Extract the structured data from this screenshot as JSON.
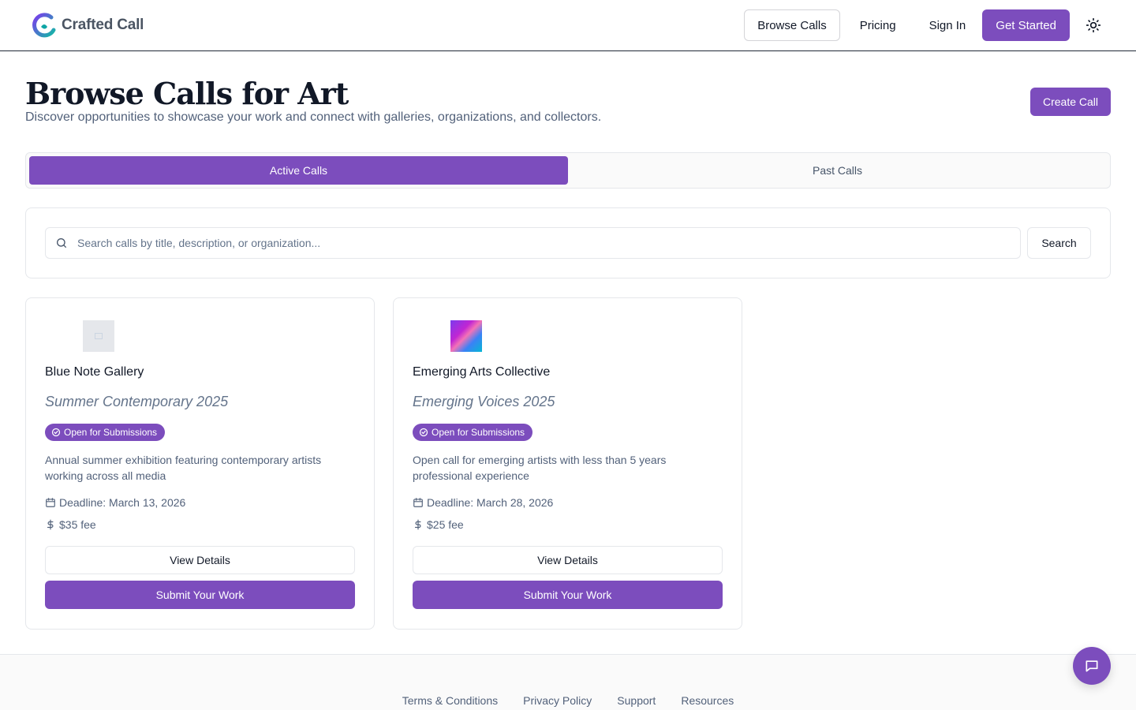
{
  "brand": {
    "name": "Crafted Call"
  },
  "nav": {
    "browse_calls": "Browse Calls",
    "pricing": "Pricing",
    "sign_in": "Sign In",
    "get_started": "Get Started",
    "theme_icon": "sun-icon"
  },
  "page": {
    "title": "Browse Calls for Art",
    "subtitle": "Discover opportunities to showcase your work and connect with galleries, organizations, and collectors.",
    "create_call": "Create Call"
  },
  "tabs": [
    {
      "label": "Active Calls",
      "active": true
    },
    {
      "label": "Past Calls",
      "active": false
    }
  ],
  "search": {
    "placeholder": "Search calls by title, description, or organization...",
    "value": "",
    "button": "Search"
  },
  "calls": [
    {
      "organization": "Blue Note Gallery",
      "title": "Summer Contemporary 2025",
      "status": "Open for Submissions",
      "description": "Annual summer exhibition featuring contemporary artists working across all media",
      "deadline": "Deadline: March 13, 2026",
      "fee": "$35 fee",
      "view_label": "View Details",
      "submit_label": "Submit Your Work"
    },
    {
      "organization": "Emerging Arts Collective",
      "title": "Emerging Voices 2025",
      "status": "Open for Submissions",
      "description": "Open call for emerging artists with less than 5 years professional experience",
      "deadline": "Deadline: March 28, 2026",
      "fee": "$25 fee",
      "view_label": "View Details",
      "submit_label": "Submit Your Work"
    }
  ],
  "footer": {
    "links": [
      "Terms & Conditions",
      "Privacy Policy",
      "Support",
      "Resources"
    ]
  },
  "colors": {
    "accent": "#7c4dbd",
    "text_muted": "#52617a",
    "border": "#e5e7eb"
  }
}
